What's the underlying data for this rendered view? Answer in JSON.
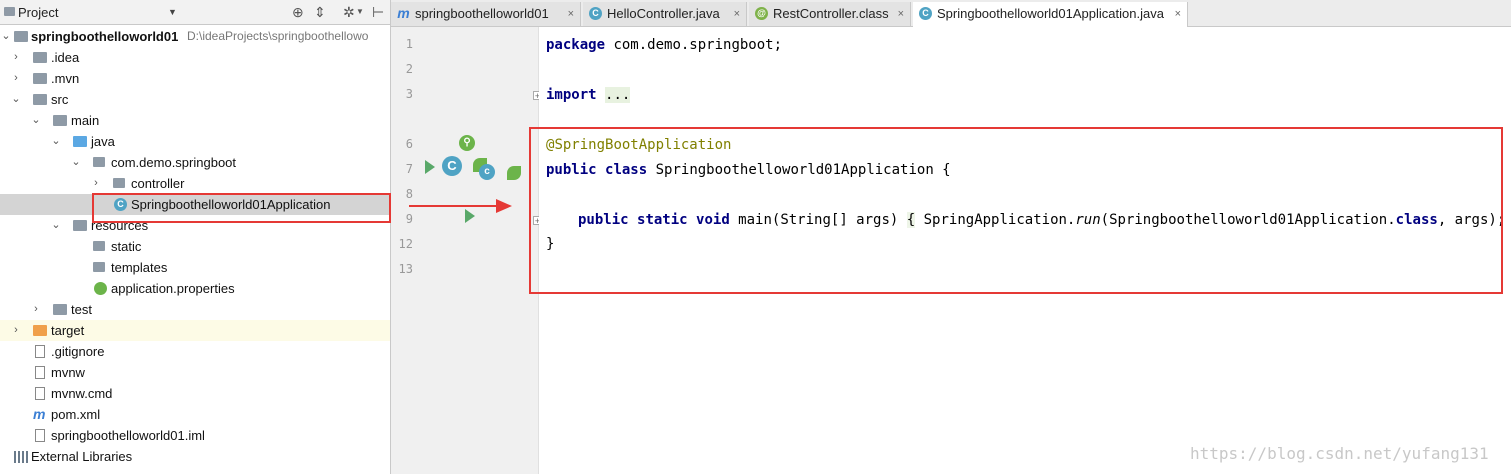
{
  "project_panel": {
    "title": "Project",
    "tree": [
      {
        "label": "springboothelloworld01",
        "path": "D:\\ideaProjects\\springboothellowo",
        "bold": true
      },
      {
        "label": ".idea"
      },
      {
        "label": ".mvn"
      },
      {
        "label": "src"
      },
      {
        "label": "main"
      },
      {
        "label": "java"
      },
      {
        "label": "com.demo.springboot"
      },
      {
        "label": "controller"
      },
      {
        "label": "Springboothelloworld01Application"
      },
      {
        "label": "resources"
      },
      {
        "label": "static"
      },
      {
        "label": "templates"
      },
      {
        "label": "application.properties"
      },
      {
        "label": "test"
      },
      {
        "label": "target"
      },
      {
        "label": ".gitignore"
      },
      {
        "label": "mvnw"
      },
      {
        "label": "mvnw.cmd"
      },
      {
        "label": "pom.xml"
      },
      {
        "label": "springboothelloworld01.iml"
      },
      {
        "label": "External Libraries"
      }
    ]
  },
  "tabs": [
    {
      "label": "springboothelloworld01",
      "icon": "maven-icon",
      "close": "×"
    },
    {
      "label": "HelloController.java",
      "icon": "class-icon",
      "close": "×"
    },
    {
      "label": "RestController.class",
      "icon": "annotation-icon",
      "close": "×"
    },
    {
      "label": "Springboothelloworld01Application.java",
      "icon": "spring-class-icon",
      "close": "×",
      "active": true
    }
  ],
  "editor": {
    "line_numbers": [
      "1",
      "2",
      "3",
      "6",
      "7",
      "8",
      "9",
      "12",
      "13"
    ],
    "code": {
      "l1_kw": "package",
      "l1_rest": " com.demo.springboot;",
      "l3_kw": "import",
      "l3_dots": "...",
      "l6_at": "@",
      "l6_ann": "SpringBootApplication",
      "l7_kw1": "public",
      "l7_kw2": "class",
      "l7_rest": " Springboothelloworld01Application {",
      "l9_kw1": "public",
      "l9_kw2": "static",
      "l9_kw3": "void",
      "l9_sig": " main(String[] args) ",
      "l9_open": "{",
      "l9_call": " SpringApplication.",
      "l9_run": "run",
      "l9_args1": "(Springboothelloworld01Application.",
      "l9_class": "class",
      "l9_args2": ", args); ",
      "l9_close": "}",
      "l12": "}"
    }
  },
  "watermark": "https://blog.csdn.net/yufang131",
  "colors": {
    "highlight": "#e53935",
    "keyword": "#000080",
    "annotation": "#808000",
    "run_icon": "#59a869"
  }
}
